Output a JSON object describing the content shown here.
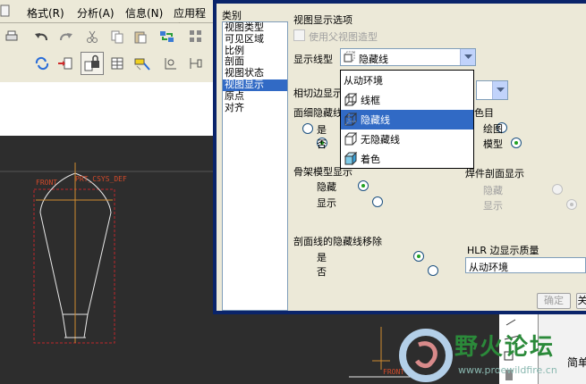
{
  "app": {
    "menu": [
      "格式(R)",
      "分析(A)",
      "信息(N)",
      "应用程序"
    ],
    "graphics": {
      "label_front": "FRONT",
      "label_csys": "PRT_CSYS_DEF",
      "label_front_bottom": "FRONT"
    },
    "right_panel_label": "简单",
    "watermark": {
      "title": "野火论坛",
      "url": "www.proewildfire.cn"
    }
  },
  "dialog": {
    "category_label": "类别",
    "categories": [
      "视图类型",
      "可见区域",
      "比例",
      "剖面",
      "视图状态",
      "视图显示",
      "原点",
      "对齐"
    ],
    "selected_category": "视图显示",
    "section_title": "视图显示选项",
    "use_parent_label": "使用父视图造型",
    "display_style_label": "显示线型",
    "display_style_value": "隐藏线",
    "dropdown_options": [
      {
        "label": "从动环境",
        "icon": ""
      },
      {
        "label": "线框",
        "icon": "wireframe-icon"
      },
      {
        "label": "隐藏线",
        "icon": "hidden-line-icon"
      },
      {
        "label": "无隐藏线",
        "icon": "no-hidden-icon"
      },
      {
        "label": "着色",
        "icon": "shaded-icon"
      }
    ],
    "dropdown_selected": "隐藏线",
    "tangent_edge_label": "相切边显示",
    "face_hidden_label": "面细隐藏线",
    "face_hidden_options": [
      {
        "label": "是",
        "on": false
      },
      {
        "label": "否",
        "on": true
      }
    ],
    "color_label": "色目",
    "color_options": [
      {
        "label": "绘图",
        "on": false
      },
      {
        "label": "模型",
        "on": true
      }
    ],
    "skeleton_label": "骨架模型显示",
    "skeleton_options": [
      {
        "label": "隐藏",
        "on": true
      },
      {
        "label": "显示",
        "on": false
      }
    ],
    "section_display_label": "焊件剖面显示",
    "section_display_options": [
      {
        "label": "隐藏",
        "on": false
      },
      {
        "label": "显示",
        "on": true
      }
    ],
    "hidden_removal_label": "剖面线的隐藏线移除",
    "hidden_removal_options": [
      {
        "label": "是",
        "on": true
      },
      {
        "label": "否",
        "on": false
      }
    ],
    "hlr_label": "HLR 边显示质量",
    "hlr_value": "从动环境",
    "ok_label": "确定",
    "close_label": "关"
  }
}
